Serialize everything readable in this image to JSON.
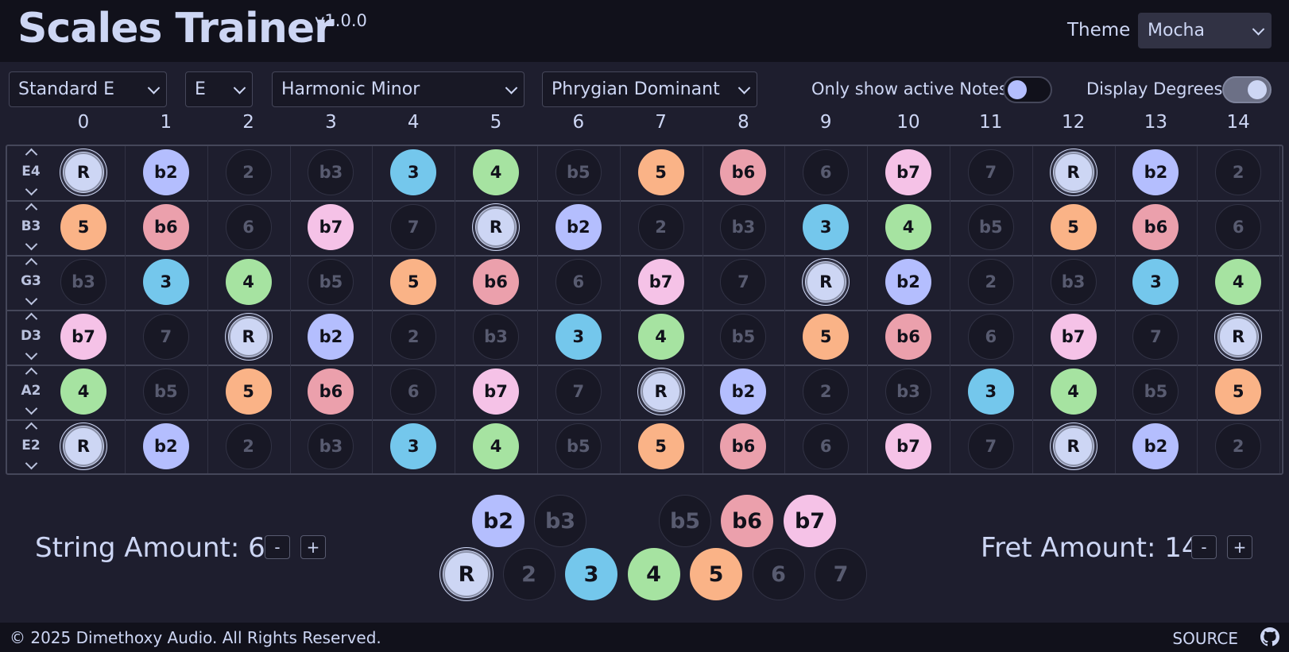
{
  "header": {
    "title": "Scales Trainer",
    "version": "v1.0.0",
    "theme_label": "Theme",
    "theme_value": "Mocha"
  },
  "toolbar": {
    "tuning": "Standard E",
    "key": "E",
    "scale": "Harmonic Minor",
    "mode": "Phrygian Dominant",
    "active_notes_label": "Only show active Notes",
    "active_notes_on": false,
    "degrees_label": "Display Degrees",
    "degrees_on": true
  },
  "fretboard": {
    "frets": [
      "0",
      "1",
      "2",
      "3",
      "4",
      "5",
      "6",
      "7",
      "8",
      "9",
      "10",
      "11",
      "12",
      "13",
      "14"
    ],
    "strings": [
      {
        "name": "E4",
        "degrees": [
          "R",
          "b2",
          "2",
          "b3",
          "3",
          "4",
          "b5",
          "5",
          "b6",
          "6",
          "b7",
          "7",
          "R",
          "b2",
          "2"
        ]
      },
      {
        "name": "B3",
        "degrees": [
          "5",
          "b6",
          "6",
          "b7",
          "7",
          "R",
          "b2",
          "2",
          "b3",
          "3",
          "4",
          "b5",
          "5",
          "b6",
          "6"
        ]
      },
      {
        "name": "G3",
        "degrees": [
          "b3",
          "3",
          "4",
          "b5",
          "5",
          "b6",
          "6",
          "b7",
          "7",
          "R",
          "b2",
          "2",
          "b3",
          "3",
          "4"
        ]
      },
      {
        "name": "D3",
        "degrees": [
          "b7",
          "7",
          "R",
          "b2",
          "2",
          "b3",
          "3",
          "4",
          "b5",
          "5",
          "b6",
          "6",
          "b7",
          "7",
          "R"
        ]
      },
      {
        "name": "A2",
        "degrees": [
          "4",
          "b5",
          "5",
          "b6",
          "6",
          "b7",
          "7",
          "R",
          "b2",
          "2",
          "b3",
          "3",
          "4",
          "b5",
          "5"
        ]
      },
      {
        "name": "E2",
        "degrees": [
          "R",
          "b2",
          "2",
          "b3",
          "3",
          "4",
          "b5",
          "5",
          "b6",
          "6",
          "b7",
          "7",
          "R",
          "b2",
          "2"
        ]
      }
    ]
  },
  "active_degrees": [
    "R",
    "b2",
    "3",
    "4",
    "5",
    "b6",
    "b7"
  ],
  "degree_colors": {
    "R": "#cdd6f4",
    "b2": "#b4befe",
    "3": "#74c7ec",
    "4": "#a6e3a1",
    "5": "#fab387",
    "b6": "#eba0ac",
    "b7": "#f5c2e7"
  },
  "legend": {
    "top": [
      "b2",
      "b3",
      "b5",
      "b6",
      "b7"
    ],
    "bottom": [
      "R",
      "2",
      "3",
      "4",
      "5",
      "6",
      "7"
    ]
  },
  "controls": {
    "string_amount_label": "String Amount: 6",
    "fret_amount_label": "Fret Amount: 14",
    "minus": "-",
    "plus": "+"
  },
  "footer": {
    "copyright": "© 2025 Dimethoxy Audio. All Rights Reserved.",
    "source": "SOURCE"
  }
}
